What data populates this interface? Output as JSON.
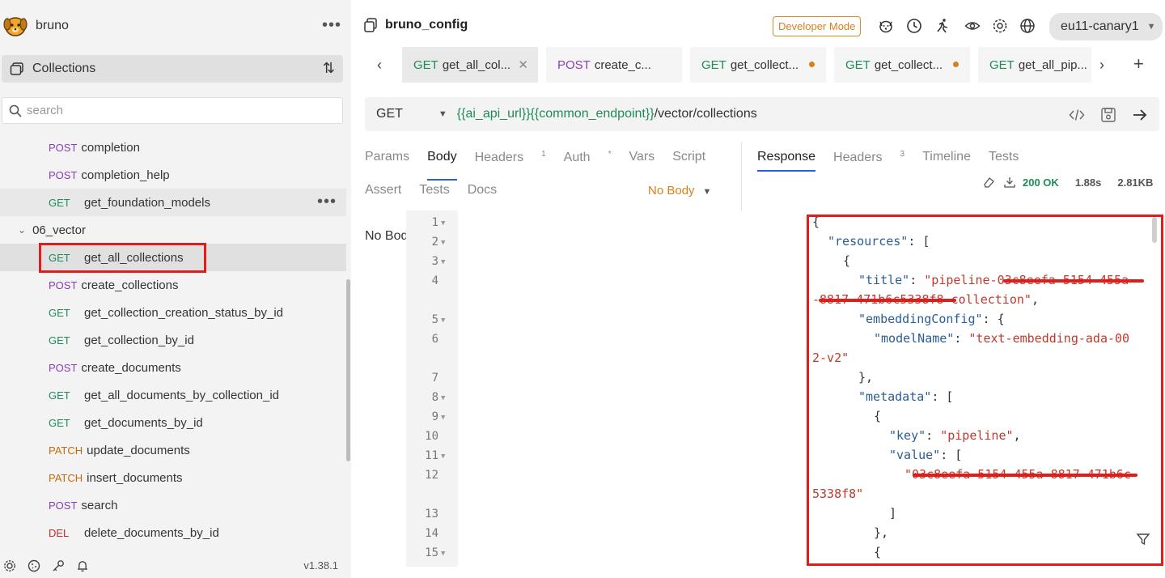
{
  "sidebar": {
    "app_name": "bruno",
    "collections_label": "Collections",
    "search_placeholder": "search",
    "items": [
      {
        "method": "POST",
        "name": "completion"
      },
      {
        "method": "POST",
        "name": "completion_help"
      },
      {
        "method": "GET",
        "name": "get_foundation_models"
      },
      {
        "folder": "06_vector"
      },
      {
        "method": "GET",
        "name": "get_all_collections"
      },
      {
        "method": "POST",
        "name": "create_collections"
      },
      {
        "method": "GET",
        "name": "get_collection_creation_status_by_id"
      },
      {
        "method": "GET",
        "name": "get_collection_by_id"
      },
      {
        "method": "POST",
        "name": "create_documents"
      },
      {
        "method": "GET",
        "name": "get_all_documents_by_collection_id"
      },
      {
        "method": "GET",
        "name": "get_documents_by_id"
      },
      {
        "method": "PATCH",
        "name": "update_documents"
      },
      {
        "method": "PATCH",
        "name": "insert_documents"
      },
      {
        "method": "POST",
        "name": "search"
      },
      {
        "method": "DEL",
        "name": "delete_documents_by_id"
      }
    ],
    "version": "v1.38.1"
  },
  "header": {
    "collection_name": "bruno_config",
    "mode_badge": "Developer Mode",
    "environment": "eu11-canary1"
  },
  "tabs": [
    {
      "method": "GET",
      "label": "get_all_col...",
      "state": "active"
    },
    {
      "method": "POST",
      "label": "create_c...",
      "state": "normal"
    },
    {
      "method": "GET",
      "label": "get_collect...",
      "state": "modified"
    },
    {
      "method": "GET",
      "label": "get_collect...",
      "state": "modified"
    },
    {
      "method": "GET",
      "label": "get_all_pip...",
      "state": "normal"
    }
  ],
  "request": {
    "method": "GET",
    "url_var1": "{{ai_api_url}}",
    "url_var2": "{{common_endpoint}}",
    "url_path": "/vector/collections",
    "tabs": [
      "Params",
      "Body",
      "Headers",
      "Auth",
      "Vars",
      "Script"
    ],
    "tabs_row2": [
      "Assert",
      "Tests",
      "Docs"
    ],
    "headers_count": "1",
    "auth_marker": "*",
    "body_mode": "No Body",
    "body_message": "No Body"
  },
  "response": {
    "tabs": [
      "Response",
      "Headers",
      "Timeline",
      "Tests"
    ],
    "headers_count": "3",
    "status": "200 OK",
    "time": "1.88s",
    "size": "2.81KB",
    "line_numbers": [
      "1",
      "2",
      "3",
      "4",
      "5",
      "6",
      "7",
      "8",
      "9",
      "10",
      "11",
      "12",
      "13",
      "14",
      "15"
    ],
    "lines": {
      "l1": "{",
      "l2_key": "\"resources\"",
      "l2_rest": ": [",
      "l3": "{",
      "l4_key": "\"title\"",
      "l4_val": "\"pipeline-03c8eefa-5154-455a",
      "l4b_val": "-8817-471b6c5338f8-collection\"",
      "l4b_rest": ",",
      "l5_key": "\"embeddingConfig\"",
      "l5_rest": ": {",
      "l6_key": "\"modelName\"",
      "l6_val": "\"text-embedding-ada-00",
      "l6b_val": "2-v2\"",
      "l7": "},",
      "l8_key": "\"metadata\"",
      "l8_rest": ": [",
      "l9": "{",
      "l10_key": "\"key\"",
      "l10_val": "\"pipeline\"",
      "l10_rest": ",",
      "l11_key": "\"value\"",
      "l11_rest": ": [",
      "l12_val": "\"03c8eefa-5154-455a-8817-471b6c",
      "l12b_val": "5338f8\"",
      "l13": "]",
      "l14": "},",
      "l15": "{"
    }
  }
}
